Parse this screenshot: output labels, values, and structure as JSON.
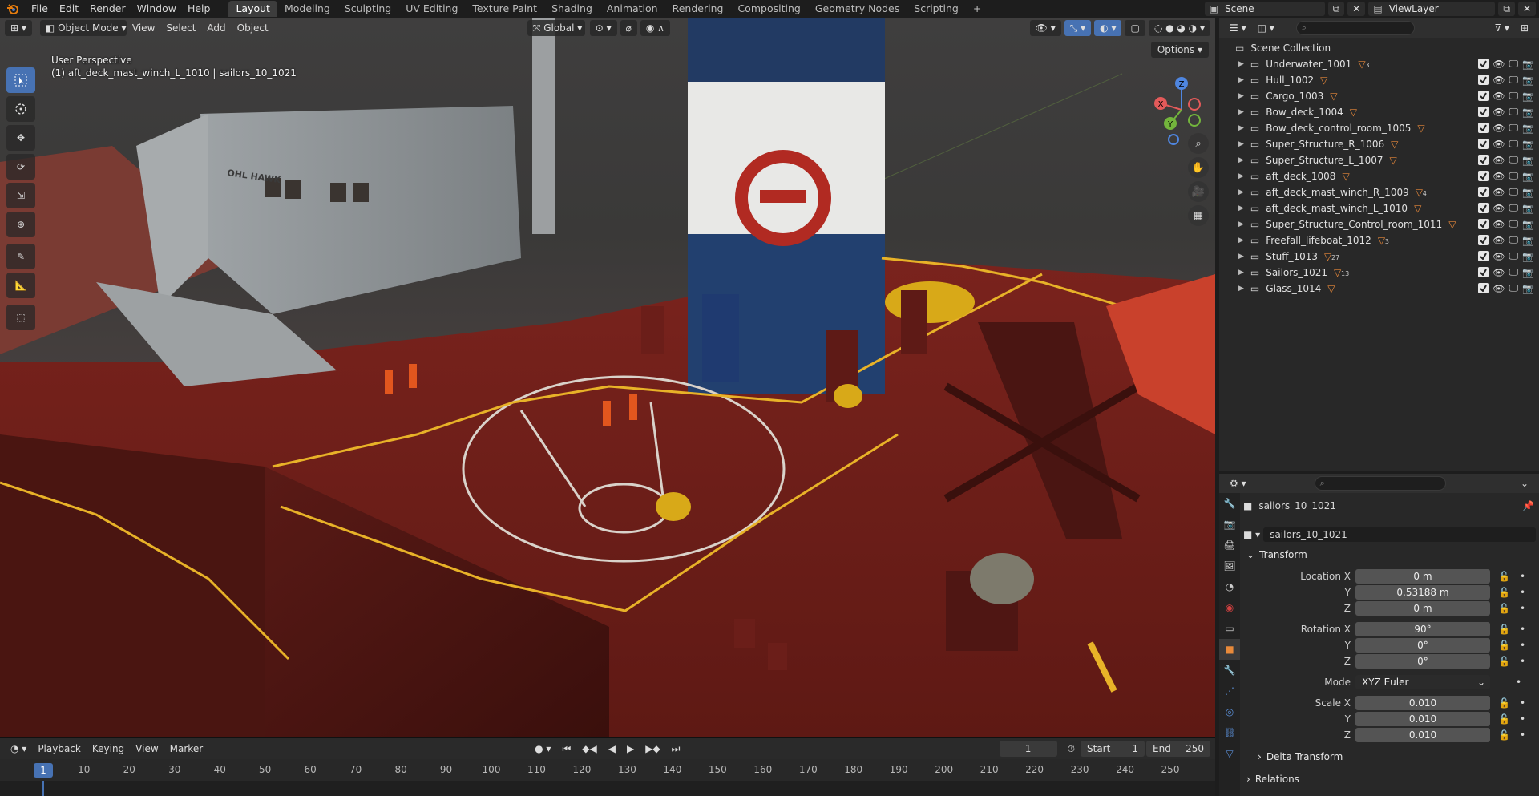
{
  "top_menu": {
    "items": [
      "File",
      "Edit",
      "Render",
      "Window",
      "Help"
    ]
  },
  "workspaces": {
    "tabs": [
      "Layout",
      "Modeling",
      "Sculpting",
      "UV Editing",
      "Texture Paint",
      "Shading",
      "Animation",
      "Rendering",
      "Compositing",
      "Geometry Nodes",
      "Scripting"
    ],
    "active": "Layout",
    "add_symbol": "+"
  },
  "scene_selector": {
    "value": "Scene"
  },
  "viewlayer_selector": {
    "value": "ViewLayer"
  },
  "viewport": {
    "mode": "Object Mode",
    "menus": [
      "View",
      "Select",
      "Add",
      "Object"
    ],
    "transform_orientation": "Global",
    "view_name": "User Perspective",
    "active_object_info": "(1) aft_deck_mast_winch_L_1010 | sailors_10_1021",
    "options_label": "Options",
    "gizmo_axes": {
      "x": "X",
      "y": "Y",
      "z": "Z"
    },
    "scene_texts": {
      "ship_name": "OHL HAWK"
    }
  },
  "timeline": {
    "menus": [
      "Playback",
      "Keying",
      "View",
      "Marker"
    ],
    "current_frame": "1",
    "start_label": "Start",
    "start_value": "1",
    "end_label": "End",
    "end_value": "250",
    "ruler_current": "1",
    "ruler_labels": [
      "10",
      "20",
      "30",
      "40",
      "50",
      "60",
      "70",
      "80",
      "90",
      "100",
      "110",
      "120",
      "130",
      "140",
      "150",
      "160",
      "170",
      "180",
      "190",
      "200",
      "210",
      "220",
      "230",
      "240",
      "250"
    ]
  },
  "outliner": {
    "root": "Scene Collection",
    "items": [
      {
        "name": "Underwater_1001",
        "badge": "3"
      },
      {
        "name": "Hull_1002",
        "badge": ""
      },
      {
        "name": "Cargo_1003",
        "badge": ""
      },
      {
        "name": "Bow_deck_1004",
        "badge": ""
      },
      {
        "name": "Bow_deck_control_room_1005",
        "badge": ""
      },
      {
        "name": "Super_Structure_R_1006",
        "badge": ""
      },
      {
        "name": "Super_Structure_L_1007",
        "badge": ""
      },
      {
        "name": "aft_deck_1008",
        "badge": ""
      },
      {
        "name": "aft_deck_mast_winch_R_1009",
        "badge": "4"
      },
      {
        "name": "aft_deck_mast_winch_L_1010",
        "badge": ""
      },
      {
        "name": "Super_Structure_Control_room_1011",
        "badge": ""
      },
      {
        "name": "Freefall_lifeboat_1012",
        "badge": "3"
      },
      {
        "name": "Stuff_1013",
        "badge": "27"
      },
      {
        "name": "Sailors_1021",
        "badge": "13"
      },
      {
        "name": "Glass_1014",
        "badge": ""
      }
    ]
  },
  "properties": {
    "object_name": "sailors_10_1021",
    "data_name": "sailors_10_1021",
    "transform_label": "Transform",
    "location": {
      "label": "Location X",
      "x": "0 m",
      "y": "0.53188 m",
      "z": "0 m"
    },
    "rotation": {
      "label": "Rotation X",
      "x": "90°",
      "y": "0°",
      "z": "0°"
    },
    "mode_label": "Mode",
    "mode_value": "XYZ Euler",
    "scale": {
      "label": "Scale X",
      "x": "0.010",
      "y": "0.010",
      "z": "0.010"
    },
    "axis_y": "Y",
    "axis_z": "Z",
    "delta_transform_label": "Delta Transform",
    "relations_label": "Relations"
  },
  "colors": {
    "accent_blue": "#4772b3",
    "deck_red": "#8a1f1a",
    "railing_yellow": "#e8b228",
    "outliner_triangle": "#e7883a"
  }
}
